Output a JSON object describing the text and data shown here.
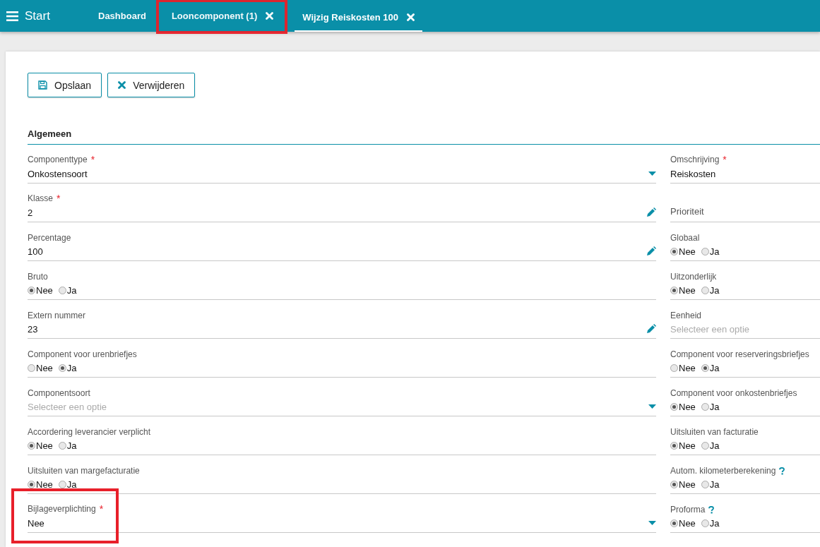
{
  "topbar": {
    "start": "Start",
    "tabs": [
      {
        "label": "Dashboard",
        "selected": false,
        "closable": false
      },
      {
        "label": "Looncomponent (1)",
        "selected": false,
        "closable": true,
        "highlighted": true
      },
      {
        "label": "Wijzig Reiskosten 100",
        "selected": true,
        "closable": true
      }
    ]
  },
  "toolbar": {
    "buttons": [
      {
        "label": "Opslaan",
        "kind": "save"
      },
      {
        "label": "Verwijderen",
        "kind": "delete"
      }
    ]
  },
  "section": {
    "title": "Algemeen"
  },
  "left_fields": [
    {
      "label": "Componenttype",
      "required_mark": "*",
      "kind": "select",
      "value": "Onkostensoort"
    },
    {
      "label": "Klasse",
      "required_mark": "*",
      "kind": "edit",
      "value": "2"
    },
    {
      "label": "Percentage",
      "kind": "edit",
      "value": "100"
    },
    {
      "label": "Bruto",
      "kind": "radio",
      "options": [
        {
          "label": "Nee",
          "selected": true
        },
        {
          "label": "Ja",
          "selected": false
        }
      ]
    },
    {
      "label": "Extern nummer",
      "kind": "edit",
      "value": "23"
    },
    {
      "label": "Component voor urenbriefjes",
      "kind": "radio",
      "options": [
        {
          "label": "Nee",
          "selected": false
        },
        {
          "label": "Ja",
          "selected": true
        }
      ]
    },
    {
      "label": "Componentsoort",
      "kind": "select",
      "placeholder": "Selecteer een optie"
    },
    {
      "label": "Accordering leverancier verplicht",
      "kind": "radio",
      "options": [
        {
          "label": "Nee",
          "selected": true
        },
        {
          "label": "Ja",
          "selected": false
        }
      ]
    },
    {
      "label": "Uitsluiten van margefacturatie",
      "kind": "radio",
      "options": [
        {
          "label": "Nee",
          "selected": true
        },
        {
          "label": "Ja",
          "selected": false
        }
      ]
    },
    {
      "label": "Bijlageverplichting",
      "required_mark": "*",
      "kind": "select",
      "value": "Nee",
      "highlighted": true
    }
  ],
  "right_fields": [
    {
      "label": "Omschrijving",
      "required_mark": "*",
      "kind": "text",
      "value": "Reiskosten"
    },
    {
      "label": "Prioriteit",
      "kind": "empty"
    },
    {
      "label": "Globaal",
      "kind": "radio",
      "options": [
        {
          "label": "Nee",
          "selected": true
        },
        {
          "label": "Ja",
          "selected": false
        }
      ]
    },
    {
      "label": "Uitzonderlijk",
      "kind": "radio",
      "options": [
        {
          "label": "Nee",
          "selected": true
        },
        {
          "label": "Ja",
          "selected": false
        }
      ]
    },
    {
      "label": "Eenheid",
      "kind": "text",
      "placeholder": "Selecteer een optie"
    },
    {
      "label": "Component voor reserveringsbriefjes",
      "kind": "radio",
      "options": [
        {
          "label": "Nee",
          "selected": false
        },
        {
          "label": "Ja",
          "selected": true
        }
      ]
    },
    {
      "label": "Component voor onkostenbriefjes",
      "kind": "radio",
      "options": [
        {
          "label": "Nee",
          "selected": true
        },
        {
          "label": "Ja",
          "selected": false
        }
      ]
    },
    {
      "label": "Uitsluiten van facturatie",
      "kind": "radio",
      "options": [
        {
          "label": "Nee",
          "selected": true
        },
        {
          "label": "Ja",
          "selected": false
        }
      ]
    },
    {
      "label": "Autom. kilometerberekening",
      "kind": "radio",
      "options": [
        {
          "label": "Nee",
          "selected": true
        },
        {
          "label": "Ja",
          "selected": false
        }
      ],
      "help": true
    },
    {
      "label": "Proforma",
      "kind": "radio",
      "options": [
        {
          "label": "Nee",
          "selected": true
        },
        {
          "label": "Ja",
          "selected": false
        }
      ],
      "help": true
    }
  ]
}
